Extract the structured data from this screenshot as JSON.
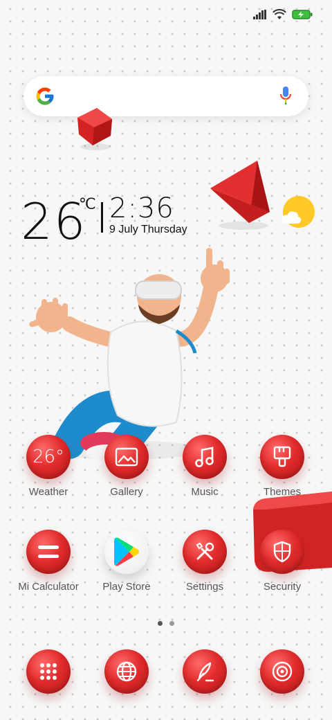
{
  "weather_widget": {
    "temperature": "26",
    "unit": "℃",
    "time": "2:36",
    "date": "9 July Thursday"
  },
  "apps": [
    {
      "label": "Weather",
      "badge": "26°"
    },
    {
      "label": "Gallery"
    },
    {
      "label": "Music"
    },
    {
      "label": "Themes"
    },
    {
      "label": "Mi Calculator"
    },
    {
      "label": "Play Store"
    },
    {
      "label": "Settings"
    },
    {
      "label": "Security"
    }
  ],
  "dock": [
    "app-drawer",
    "browser",
    "notes",
    "camera"
  ],
  "page_indicator": {
    "pages": 2,
    "current": 1
  },
  "colors": {
    "accent": "#e12b2b",
    "label": "#555555",
    "background": "#f7f7f7"
  },
  "icons": [
    "signal-icon",
    "wifi-icon",
    "battery-charging-icon",
    "google-logo-icon",
    "mic-icon"
  ]
}
